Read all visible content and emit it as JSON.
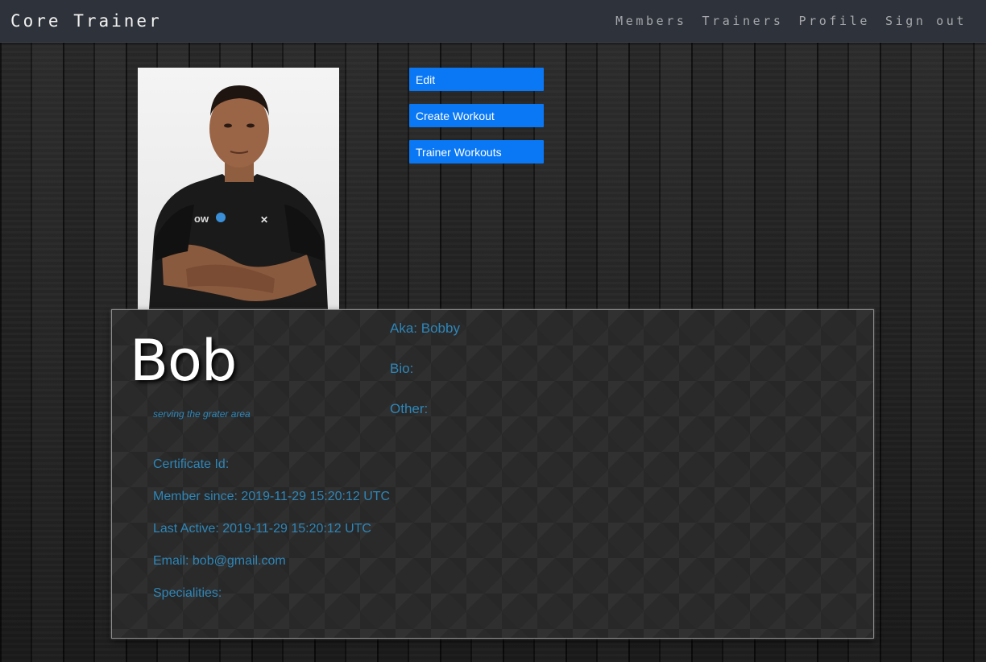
{
  "navbar": {
    "brand": "Core Trainer",
    "links": [
      "Members",
      "Trainers",
      "Profile",
      "Sign out"
    ]
  },
  "actions": {
    "edit": "Edit",
    "create_workout": "Create Workout",
    "trainer_workouts": "Trainer Workouts"
  },
  "profile": {
    "name": "Bob",
    "tagline": "serving the grater area",
    "certificate": "Certificate Id:",
    "member_since": "Member since: 2019-11-29 15:20:12 UTC",
    "last_active": "Last Active: 2019-11-29 15:20:12 UTC",
    "email": "Email: bob@gmail.com",
    "specialities": "Specialities:",
    "aka": "Aka: Bobby",
    "bio": "Bio:",
    "other": "Other:"
  },
  "colors": {
    "accent": "#0a78f5",
    "field_text": "#2e86b8",
    "navbar": "#2e323a"
  }
}
